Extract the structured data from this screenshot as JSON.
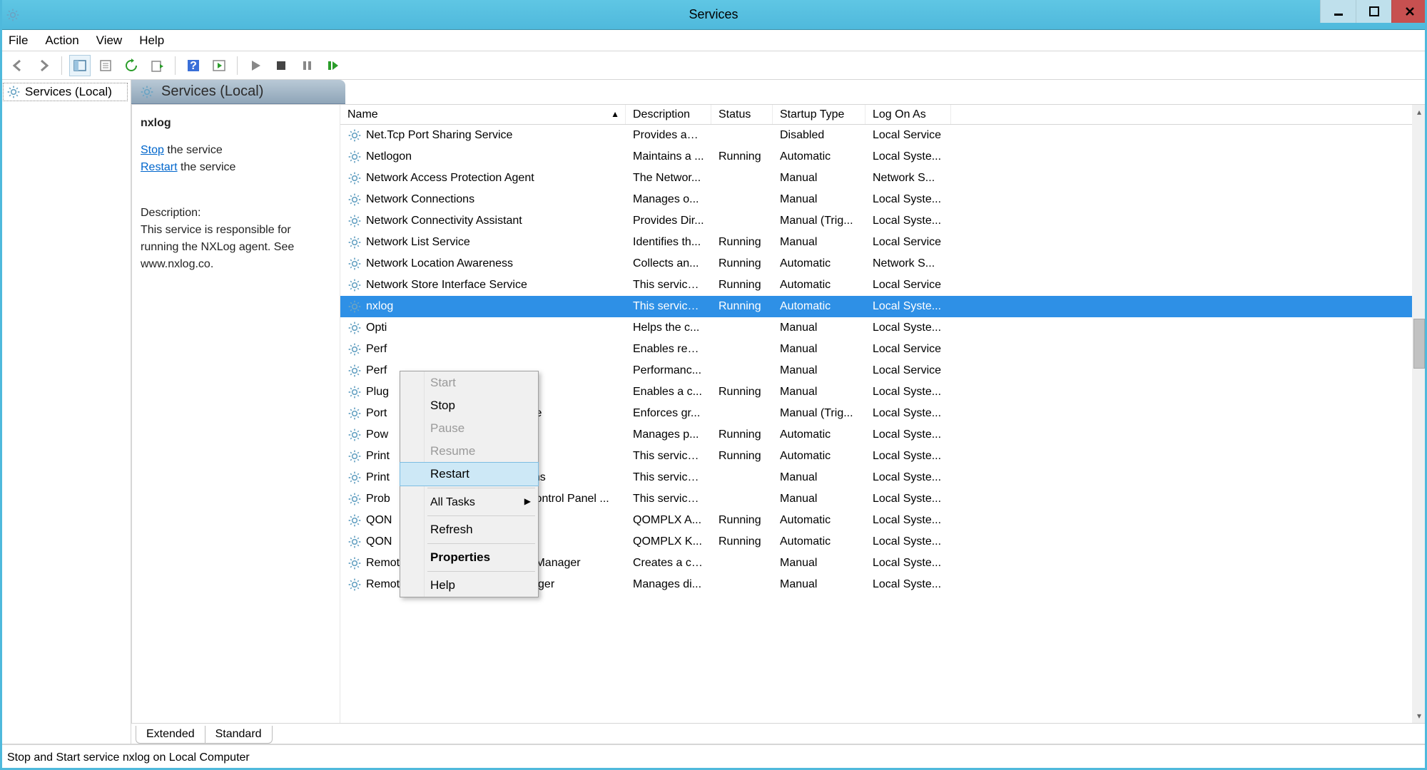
{
  "window": {
    "title": "Services"
  },
  "menus": {
    "file": "File",
    "action": "Action",
    "view": "View",
    "help": "Help"
  },
  "tree": {
    "root": "Services (Local)"
  },
  "header": {
    "label": "Services (Local)"
  },
  "detail": {
    "service_name": "nxlog",
    "stop_link": "Stop",
    "stop_suffix": " the service",
    "restart_link": "Restart",
    "restart_suffix": " the service",
    "desc_heading": "Description:",
    "desc_text": "This service is responsible for running the NXLog agent. See www.nxlog.co."
  },
  "columns": {
    "name": "Name",
    "desc": "Description",
    "status": "Status",
    "startup": "Startup Type",
    "logon": "Log On As"
  },
  "rows": [
    {
      "name": "Net.Tcp Port Sharing Service",
      "desc": "Provides abi...",
      "status": "",
      "startup": "Disabled",
      "logon": "Local Service"
    },
    {
      "name": "Netlogon",
      "desc": "Maintains a ...",
      "status": "Running",
      "startup": "Automatic",
      "logon": "Local Syste..."
    },
    {
      "name": "Network Access Protection Agent",
      "desc": "The Networ...",
      "status": "",
      "startup": "Manual",
      "logon": "Network S..."
    },
    {
      "name": "Network Connections",
      "desc": "Manages o...",
      "status": "",
      "startup": "Manual",
      "logon": "Local Syste..."
    },
    {
      "name": "Network Connectivity Assistant",
      "desc": "Provides Dir...",
      "status": "",
      "startup": "Manual (Trig...",
      "logon": "Local Syste..."
    },
    {
      "name": "Network List Service",
      "desc": "Identifies th...",
      "status": "Running",
      "startup": "Manual",
      "logon": "Local Service"
    },
    {
      "name": "Network Location Awareness",
      "desc": "Collects an...",
      "status": "Running",
      "startup": "Automatic",
      "logon": "Network S..."
    },
    {
      "name": "Network Store Interface Service",
      "desc": "This service ...",
      "status": "Running",
      "startup": "Automatic",
      "logon": "Local Service"
    },
    {
      "name": "nxlog",
      "desc": "This service ...",
      "status": "Running",
      "startup": "Automatic",
      "logon": "Local Syste...",
      "selected": true
    },
    {
      "name": "Opti",
      "desc": "Helps the c...",
      "status": "",
      "startup": "Manual",
      "logon": "Local Syste..."
    },
    {
      "name": "Perf",
      "desc": "Enables rem...",
      "status": "",
      "startup": "Manual",
      "logon": "Local Service"
    },
    {
      "name": "Perf",
      "desc": "Performanc...",
      "status": "",
      "startup": "Manual",
      "logon": "Local Service"
    },
    {
      "name": "Plug",
      "desc": "Enables a c...",
      "status": "Running",
      "startup": "Manual",
      "logon": "Local Syste..."
    },
    {
      "name": "Port",
      "name_suffix": "ice",
      "desc": "Enforces gr...",
      "status": "",
      "startup": "Manual (Trig...",
      "logon": "Local Syste..."
    },
    {
      "name": "Pow",
      "desc": "Manages p...",
      "status": "Running",
      "startup": "Automatic",
      "logon": "Local Syste..."
    },
    {
      "name": "Print",
      "desc": "This service ...",
      "status": "Running",
      "startup": "Automatic",
      "logon": "Local Syste..."
    },
    {
      "name": "Print",
      "name_suffix": "ons",
      "desc": "This service ...",
      "status": "",
      "startup": "Manual",
      "logon": "Local Syste..."
    },
    {
      "name": "Prob",
      "name_suffix": "Control Panel ...",
      "desc": "This service ...",
      "status": "",
      "startup": "Manual",
      "logon": "Local Syste..."
    },
    {
      "name": "QON",
      "desc": "QOMPLX A...",
      "status": "Running",
      "startup": "Automatic",
      "logon": "Local Syste..."
    },
    {
      "name": "QON",
      "desc": "QOMPLX K...",
      "status": "Running",
      "startup": "Automatic",
      "logon": "Local Syste..."
    },
    {
      "name": "Remote Access Auto Connection Manager",
      "desc": "Creates a co...",
      "status": "",
      "startup": "Manual",
      "logon": "Local Syste..."
    },
    {
      "name": "Remote Access Connection Manager",
      "desc": "Manages di...",
      "status": "",
      "startup": "Manual",
      "logon": "Local Syste..."
    }
  ],
  "context_menu": {
    "start": "Start",
    "stop": "Stop",
    "pause": "Pause",
    "resume": "Resume",
    "restart": "Restart",
    "all_tasks": "All Tasks",
    "refresh": "Refresh",
    "properties": "Properties",
    "help": "Help"
  },
  "tabs": {
    "extended": "Extended",
    "standard": "Standard"
  },
  "statusbar": {
    "text": "Stop and Start service nxlog on Local Computer"
  }
}
